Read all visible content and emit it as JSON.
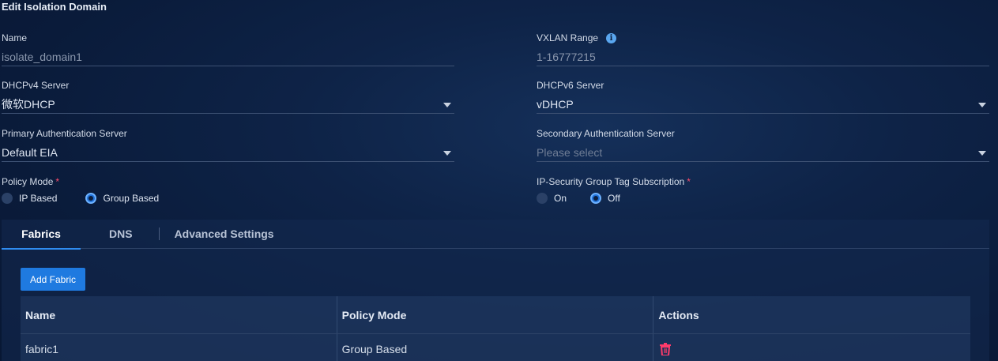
{
  "page": {
    "title": "Edit Isolation Domain"
  },
  "fields": {
    "name": {
      "label": "Name",
      "value": "isolate_domain1"
    },
    "vxlan": {
      "label": "VXLAN Range",
      "value": "1-16777215"
    },
    "dhcpv4": {
      "label": "DHCPv4 Server",
      "value": "微软DHCP"
    },
    "dhcpv6": {
      "label": "DHCPv6 Server",
      "value": "vDHCP"
    },
    "primary_auth": {
      "label": "Primary Authentication Server",
      "value": "Default EIA"
    },
    "secondary_auth": {
      "label": "Secondary Authentication Server",
      "placeholder": "Please select"
    }
  },
  "policy_mode": {
    "label": "Policy Mode",
    "required": "*",
    "options": [
      "IP Based",
      "Group Based"
    ],
    "selected": "Group Based"
  },
  "sgt_subscription": {
    "label": "IP-Security Group Tag Subscription",
    "required": "*",
    "options": [
      "On",
      "Off"
    ],
    "selected": "Off"
  },
  "tabs": [
    "Fabrics",
    "DNS",
    "Advanced Settings"
  ],
  "active_tab": "Fabrics",
  "add_button": "Add Fabric",
  "table": {
    "headers": [
      "Name",
      "Policy Mode",
      "Actions"
    ],
    "rows": [
      {
        "name": "fabric1",
        "policy_mode": "Group Based",
        "action_icon": "trash-icon"
      }
    ]
  },
  "colors": {
    "accent": "#1f7ae0",
    "danger": "#ff3b6b",
    "required": "#ff4d6d"
  }
}
